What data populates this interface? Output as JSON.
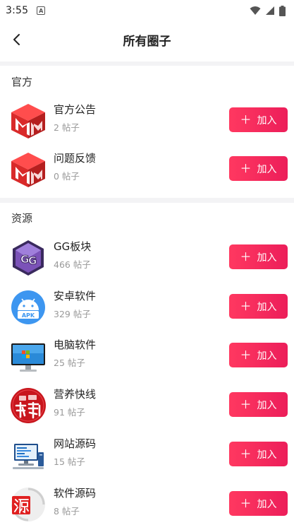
{
  "status_bar": {
    "time": "3:55",
    "notification_glyph": "A"
  },
  "header": {
    "title": "所有圈子"
  },
  "sections": [
    {
      "title": "官方",
      "items": [
        {
          "name": "官方公告",
          "count": "2 帖子",
          "icon": "red-cube-logo-icon"
        },
        {
          "name": "问题反馈",
          "count": "0 帖子",
          "icon": "red-cube-logo-icon"
        }
      ]
    },
    {
      "title": "资源",
      "items": [
        {
          "name": "GG板块",
          "count": "466 帖子",
          "icon": "gg-guardian-logo-icon"
        },
        {
          "name": "安卓软件",
          "count": "329 帖子",
          "icon": "apk-android-icon"
        },
        {
          "name": "电脑软件",
          "count": "25 帖子",
          "icon": "desktop-monitor-icon"
        },
        {
          "name": "营养快线",
          "count": "91 帖子",
          "icon": "fuli-red-circle-icon"
        },
        {
          "name": "网站源码",
          "count": "15 帖子",
          "icon": "computer-code-icon"
        },
        {
          "name": "软件源码",
          "count": "8 帖子",
          "icon": "yuan-stamp-icon"
        }
      ]
    }
  ],
  "join_label": "加入",
  "colors": {
    "accent": "#f0245c",
    "divider": "#f3f3f5"
  }
}
